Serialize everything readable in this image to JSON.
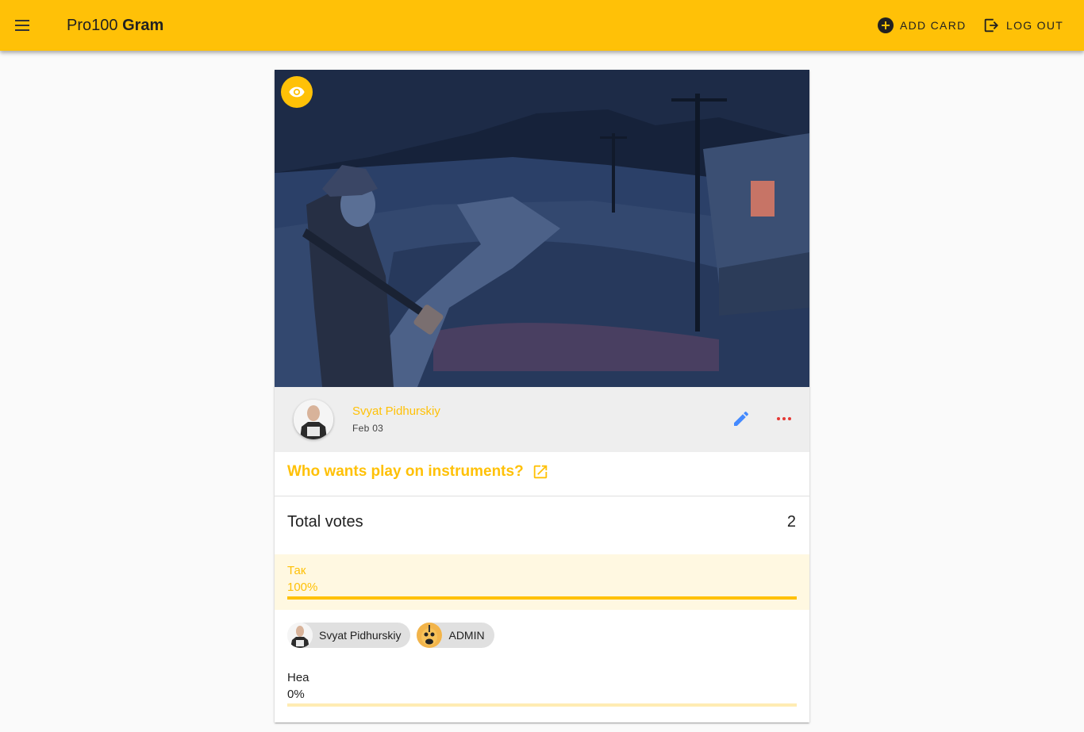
{
  "appbar": {
    "brand_light": "Pro100",
    "brand_bold": "Gram",
    "add_card_label": "ADD CARD",
    "logout_label": "LOG OUT",
    "color": "#ffc107"
  },
  "card": {
    "author": "Svyat Pidhurskiy",
    "date": "Feb 03",
    "title": "Who wants play on instruments?",
    "total_label": "Total votes",
    "total_value": "2",
    "options": [
      {
        "label": "Так",
        "percent_text": "100%",
        "fraction": 1.0,
        "voters": [
          "Svyat Pidhurskiy",
          "ADMIN"
        ]
      },
      {
        "label": "Неа",
        "percent_text": "0%",
        "fraction": 0.0,
        "voters": []
      }
    ]
  },
  "icons": {
    "menu": "menu-icon",
    "add": "add-circle-icon",
    "logout": "logout-icon",
    "view": "eye-icon",
    "edit": "pencil-icon",
    "more": "more-horizontal-icon",
    "open": "open-in-new-icon"
  },
  "colors": {
    "accent": "#ffc107",
    "accent_light": "#fff8e1",
    "edit_icon": "#448aff",
    "more_icon": "#e53935"
  }
}
